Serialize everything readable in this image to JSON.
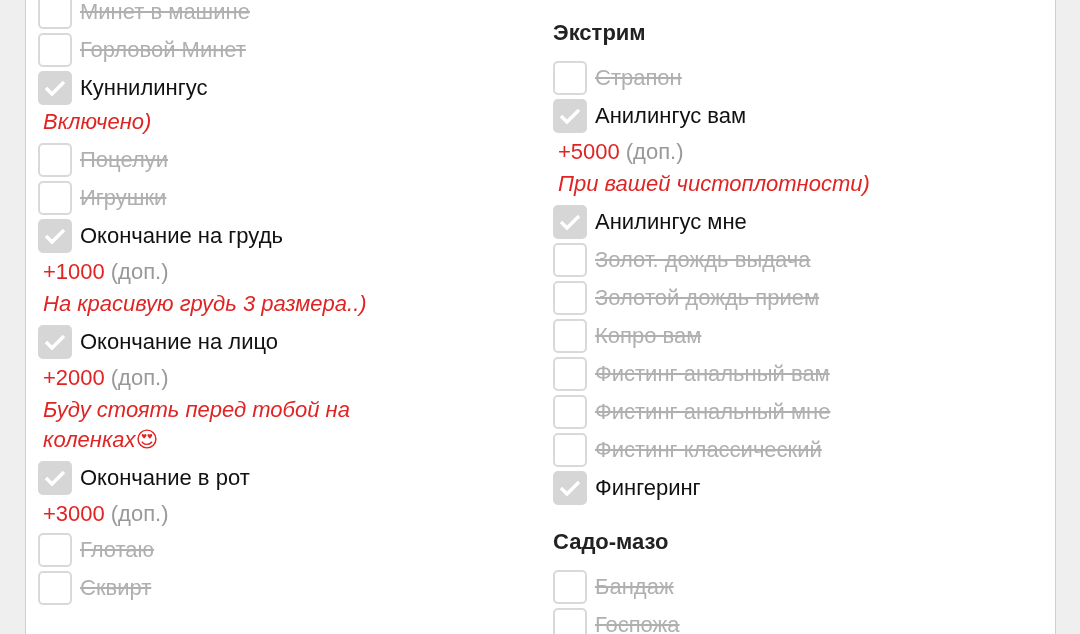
{
  "columns": [
    {
      "sections": [
        {
          "items": [
            {
              "label": "Минет в машине",
              "checked": false
            },
            {
              "label": "Горловой Минет",
              "checked": false
            },
            {
              "label": "Куннилингус",
              "checked": true,
              "note": "Включено)"
            },
            {
              "label": "Поцелуи",
              "checked": false
            },
            {
              "label": "Игрушки",
              "checked": false
            },
            {
              "label": "Окончание на грудь",
              "checked": true,
              "price": "+1000",
              "price_suffix": "(доп.)",
              "note": "На красивую грудь 3 размера..)"
            },
            {
              "label": "Окончание на лицо",
              "checked": true,
              "price": "+2000",
              "price_suffix": "(доп.)",
              "note": "Буду стоять перед тобой на коленках😍"
            },
            {
              "label": "Окончание в рот",
              "checked": true,
              "price": "+3000",
              "price_suffix": "(доп.)"
            },
            {
              "label": "Глотаю",
              "checked": false
            },
            {
              "label": "Сквирт",
              "checked": false
            }
          ]
        }
      ]
    },
    {
      "sections": [
        {
          "title": "Экстрим",
          "items": [
            {
              "label": "Страпон",
              "checked": false
            },
            {
              "label": "Анилингус вам",
              "checked": true,
              "price": "+5000",
              "price_suffix": "(доп.)",
              "note": "При вашей чистоплотности)"
            },
            {
              "label": "Анилингус мне",
              "checked": true
            },
            {
              "label": "Золот. дождь выдача",
              "checked": false
            },
            {
              "label": "Золотой дождь прием",
              "checked": false
            },
            {
              "label": "Копро вам",
              "checked": false
            },
            {
              "label": "Фистинг анальный вам",
              "checked": false
            },
            {
              "label": "Фистинг анальный мне",
              "checked": false
            },
            {
              "label": "Фистинг классический",
              "checked": false
            },
            {
              "label": "Фингеринг",
              "checked": true
            }
          ]
        },
        {
          "title": "Садо-мазо",
          "items": [
            {
              "label": "Бандаж",
              "checked": false
            },
            {
              "label": "Госпожа",
              "checked": false
            }
          ]
        }
      ]
    }
  ]
}
